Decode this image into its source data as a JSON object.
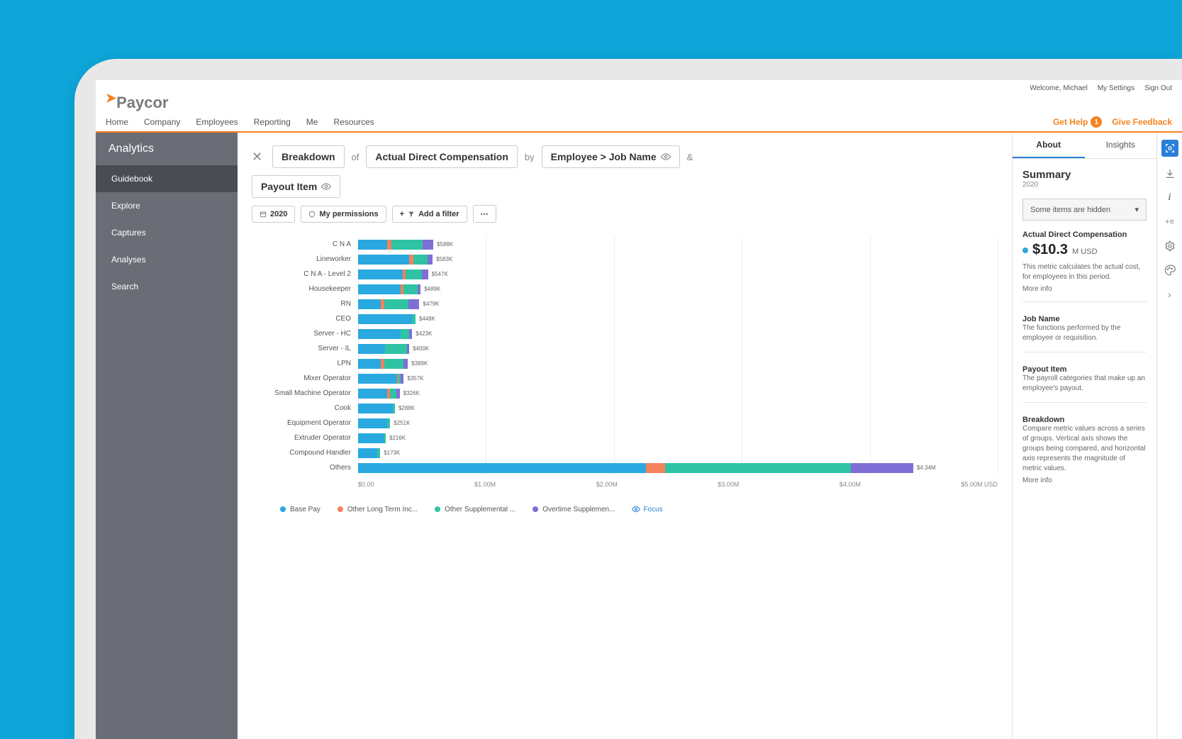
{
  "top_bar": {
    "welcome": "Welcome, Michael",
    "settings": "My Settings",
    "sign_out": "Sign Out"
  },
  "logo": "Paycor",
  "nav": {
    "items": [
      "Home",
      "Company",
      "Employees",
      "Reporting",
      "Me",
      "Resources"
    ],
    "get_help": "Get Help",
    "badge": "1",
    "give_feedback": "Give Feedback"
  },
  "sidebar": {
    "title": "Analytics",
    "items": [
      "Guidebook",
      "Explore",
      "Captures",
      "Analyses",
      "Search"
    ],
    "active_index": 0
  },
  "breadcrumb": {
    "breakdown": "Breakdown",
    "of": "of",
    "metric": "Actual Direct Compensation",
    "by": "by",
    "group": "Employee > Job Name",
    "and": "&",
    "segment": "Payout Item"
  },
  "filters": {
    "year": "2020",
    "perms": "My permissions",
    "add_filter": "Add a filter"
  },
  "chart_data": {
    "type": "bar",
    "orientation": "horizontal",
    "stacked": true,
    "xlabel": "",
    "ylabel": "",
    "xlim": [
      0,
      5000000
    ],
    "x_ticks": [
      "$0.00",
      "$1.00M",
      "$2.00M",
      "$3.00M",
      "$4.00M",
      "$5.00M USD"
    ],
    "categories": [
      "C N A",
      "Lineworker",
      "C N A - Level 2",
      "Housekeeper",
      "RN",
      "CEO",
      "Server - HC",
      "Server - IL",
      "LPN",
      "Mixer Operator",
      "Small Machine Operator",
      "Cook",
      "Equipment Operator",
      "Extruder Operator",
      "Compound Handler",
      "Others"
    ],
    "labels": [
      "$588K",
      "$583K",
      "$547K",
      "$489K",
      "$479K",
      "$448K",
      "$423K",
      "$400K",
      "$389K",
      "$357K",
      "$326K",
      "$288K",
      "$251K",
      "$216K",
      "$173K",
      "$4.34M"
    ],
    "series": [
      {
        "name": "Base Pay",
        "color": "#2aa8e0",
        "values": [
          230,
          400,
          350,
          330,
          175,
          420,
          330,
          210,
          180,
          305,
          225,
          270,
          225,
          200,
          148,
          2250
        ]
      },
      {
        "name": "Other Long Term Inc...",
        "color": "#f4825a",
        "values": [
          30,
          30,
          20,
          25,
          30,
          0,
          0,
          0,
          25,
          10,
          25,
          0,
          0,
          0,
          0,
          150
        ]
      },
      {
        "name": "Other Supplemental ...",
        "color": "#2fc3a4",
        "values": [
          245,
          115,
          127,
          109,
          190,
          28,
          70,
          170,
          150,
          17,
          50,
          18,
          26,
          16,
          25,
          1450
        ]
      },
      {
        "name": "Overtime Supplemen...",
        "color": "#7e6ed6",
        "values": [
          83,
          38,
          50,
          25,
          84,
          0,
          23,
          20,
          34,
          25,
          26,
          0,
          0,
          0,
          0,
          490
        ]
      }
    ]
  },
  "legend_focus": "Focus",
  "info_panel": {
    "tabs": [
      "About",
      "Insights"
    ],
    "active_tab": 0,
    "summary_title": "Summary",
    "summary_sub": "2020",
    "hidden_items": "Some items are hidden",
    "metric": {
      "title": "Actual Direct Compensation",
      "value": "$10.3",
      "value_suffix": "M USD",
      "desc": "This metric calculates the actual cost, for employees in this period.",
      "more": "More info"
    },
    "job_name": {
      "title": "Job Name",
      "desc": "The functions performed by the employee or requisition."
    },
    "payout_item": {
      "title": "Payout Item",
      "desc": "The payroll categories that make up an employee's payout."
    },
    "breakdown": {
      "title": "Breakdown",
      "desc": "Compare metric values across a series of groups. Vertical axis shows the groups being compared, and horizontal axis represents the magnitude of metric values.",
      "more": "More info"
    }
  }
}
